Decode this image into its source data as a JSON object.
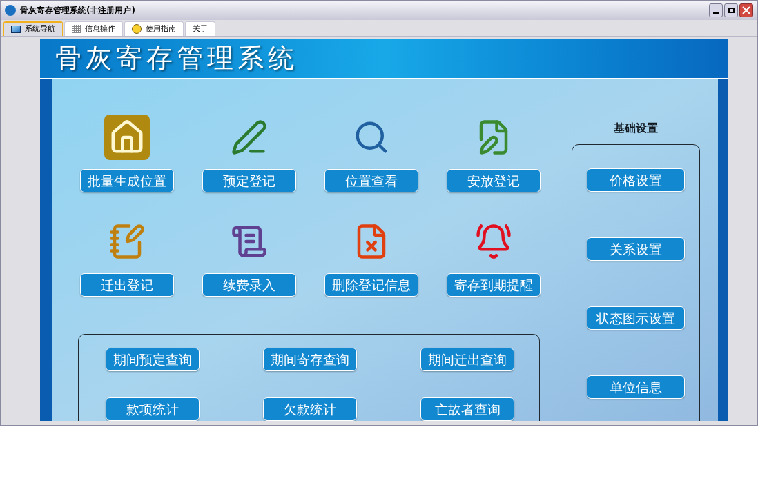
{
  "window": {
    "title": "骨灰寄存管理系统(非注册用户)"
  },
  "tabs": [
    {
      "label": "系统导航",
      "selected": true
    },
    {
      "label": "信息操作",
      "selected": false
    },
    {
      "label": "使用指南",
      "selected": false
    },
    {
      "label": "关于",
      "selected": false
    }
  ],
  "banner": {
    "title": "骨灰寄存管理系统"
  },
  "actions": [
    {
      "label": "批量生成位置"
    },
    {
      "label": "预定登记"
    },
    {
      "label": "位置查看"
    },
    {
      "label": "安放登记"
    },
    {
      "label": "迁出登记"
    },
    {
      "label": "续费录入"
    },
    {
      "label": "删除登记信息"
    },
    {
      "label": "寄存到期提醒"
    }
  ],
  "queries": [
    {
      "label": "期间预定查询"
    },
    {
      "label": "期间寄存查询"
    },
    {
      "label": "期间迁出查询"
    },
    {
      "label": "款项统计"
    },
    {
      "label": "欠款统计"
    },
    {
      "label": "亡故者查询"
    }
  ],
  "settings": {
    "title": "基础设置",
    "items": [
      {
        "label": "价格设置"
      },
      {
        "label": "关系设置"
      },
      {
        "label": "状态图示设置"
      },
      {
        "label": "单位信息"
      }
    ]
  }
}
